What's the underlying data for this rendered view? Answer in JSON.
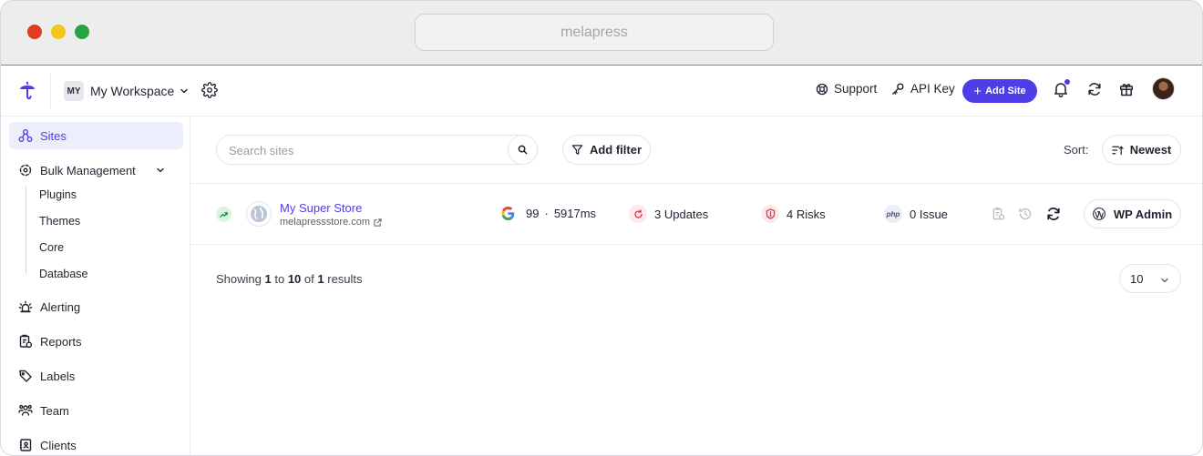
{
  "browser": {
    "url": "melapress"
  },
  "header": {
    "workspace_badge": "MY",
    "workspace_name": "My Workspace",
    "support_label": "Support",
    "api_key_label": "API Key",
    "add_site_label": "Add Site",
    "add_site_icon": "+"
  },
  "sidebar": {
    "items": [
      {
        "label": "Sites",
        "icon": "sites-icon",
        "active": true
      },
      {
        "label": "Bulk Management",
        "icon": "bulk-icon"
      },
      {
        "label": "Alerting",
        "icon": "alarm-icon"
      },
      {
        "label": "Reports",
        "icon": "report-icon"
      },
      {
        "label": "Labels",
        "icon": "tag-icon"
      },
      {
        "label": "Team",
        "icon": "team-icon"
      },
      {
        "label": "Clients",
        "icon": "clients-icon"
      }
    ],
    "bulk_sub_items": [
      "Plugins",
      "Themes",
      "Core",
      "Database"
    ]
  },
  "toolbar": {
    "search_placeholder": "Search sites",
    "add_filter_label": "Add filter",
    "sort_label": "Sort:",
    "sort_value": "Newest"
  },
  "sites": [
    {
      "name": "My Super Store",
      "url": "melapressstore.com",
      "pagespeed_score": "99",
      "separator": "·",
      "load_time": "5917ms",
      "updates": "3 Updates",
      "risks": "4 Risks",
      "issues": "0 Issue",
      "php_label": "php",
      "wp_admin_label": "WP Admin"
    }
  ],
  "pagination": {
    "prefix": "Showing",
    "from": "1",
    "to_word": "to",
    "to": "10",
    "of_word": "of",
    "total": "1",
    "suffix": "results",
    "per_page": "10"
  },
  "colors": {
    "accent": "#4f3ee8",
    "active_bg": "#eceefb",
    "trend_bg": "#d6f5df",
    "updates_bg": "#fde8ea",
    "risks_bg": "#fde8ea"
  }
}
